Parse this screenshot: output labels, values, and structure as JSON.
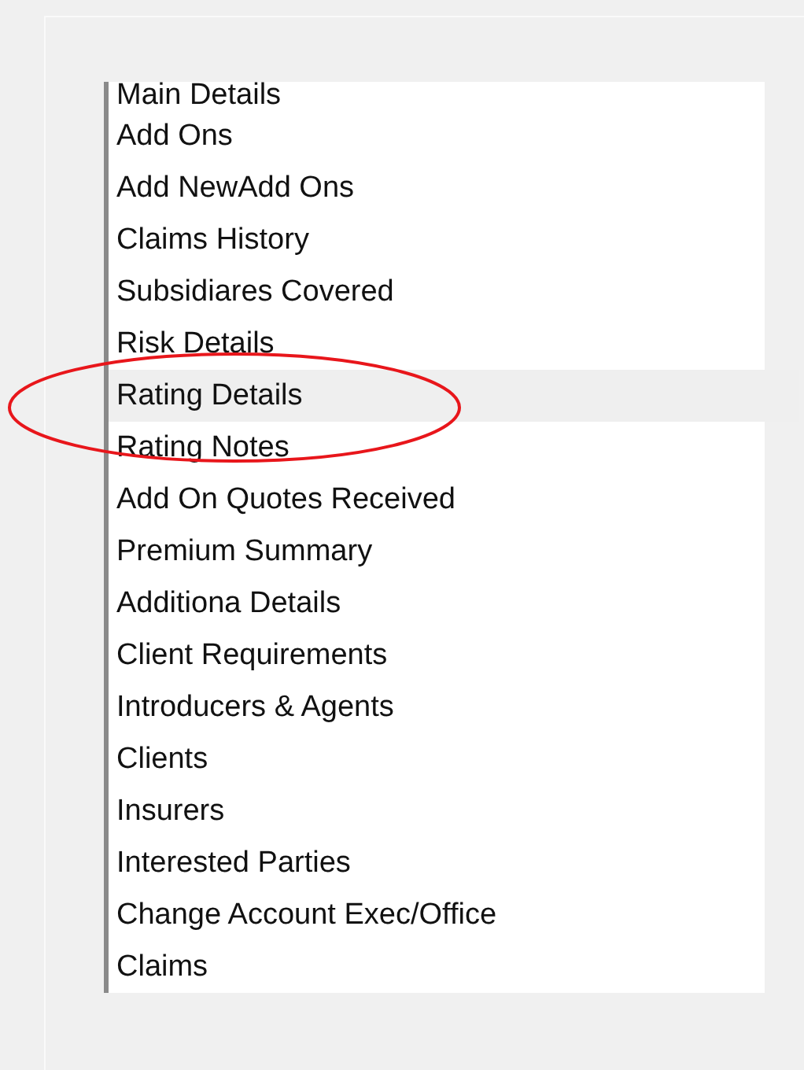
{
  "menu": {
    "items": [
      {
        "label": "Main Details",
        "selected": false
      },
      {
        "label": "Add Ons",
        "selected": false
      },
      {
        "label": "Add NewAdd Ons",
        "selected": false
      },
      {
        "label": "Claims History",
        "selected": false
      },
      {
        "label": "Subsidiares Covered",
        "selected": false
      },
      {
        "label": "Risk Details",
        "selected": false
      },
      {
        "label": "Rating Details",
        "selected": true
      },
      {
        "label": "Rating Notes",
        "selected": false
      },
      {
        "label": "Add On Quotes Received",
        "selected": false
      },
      {
        "label": "Premium Summary",
        "selected": false
      },
      {
        "label": "Additiona Details",
        "selected": false
      },
      {
        "label": "Client Requirements",
        "selected": false
      },
      {
        "label": "Introducers & Agents",
        "selected": false
      },
      {
        "label": "Clients",
        "selected": false
      },
      {
        "label": "Insurers",
        "selected": false
      },
      {
        "label": "Interested Parties",
        "selected": false
      },
      {
        "label": "Change Account Exec/Office",
        "selected": false
      },
      {
        "label": "Claims",
        "selected": false
      }
    ]
  }
}
